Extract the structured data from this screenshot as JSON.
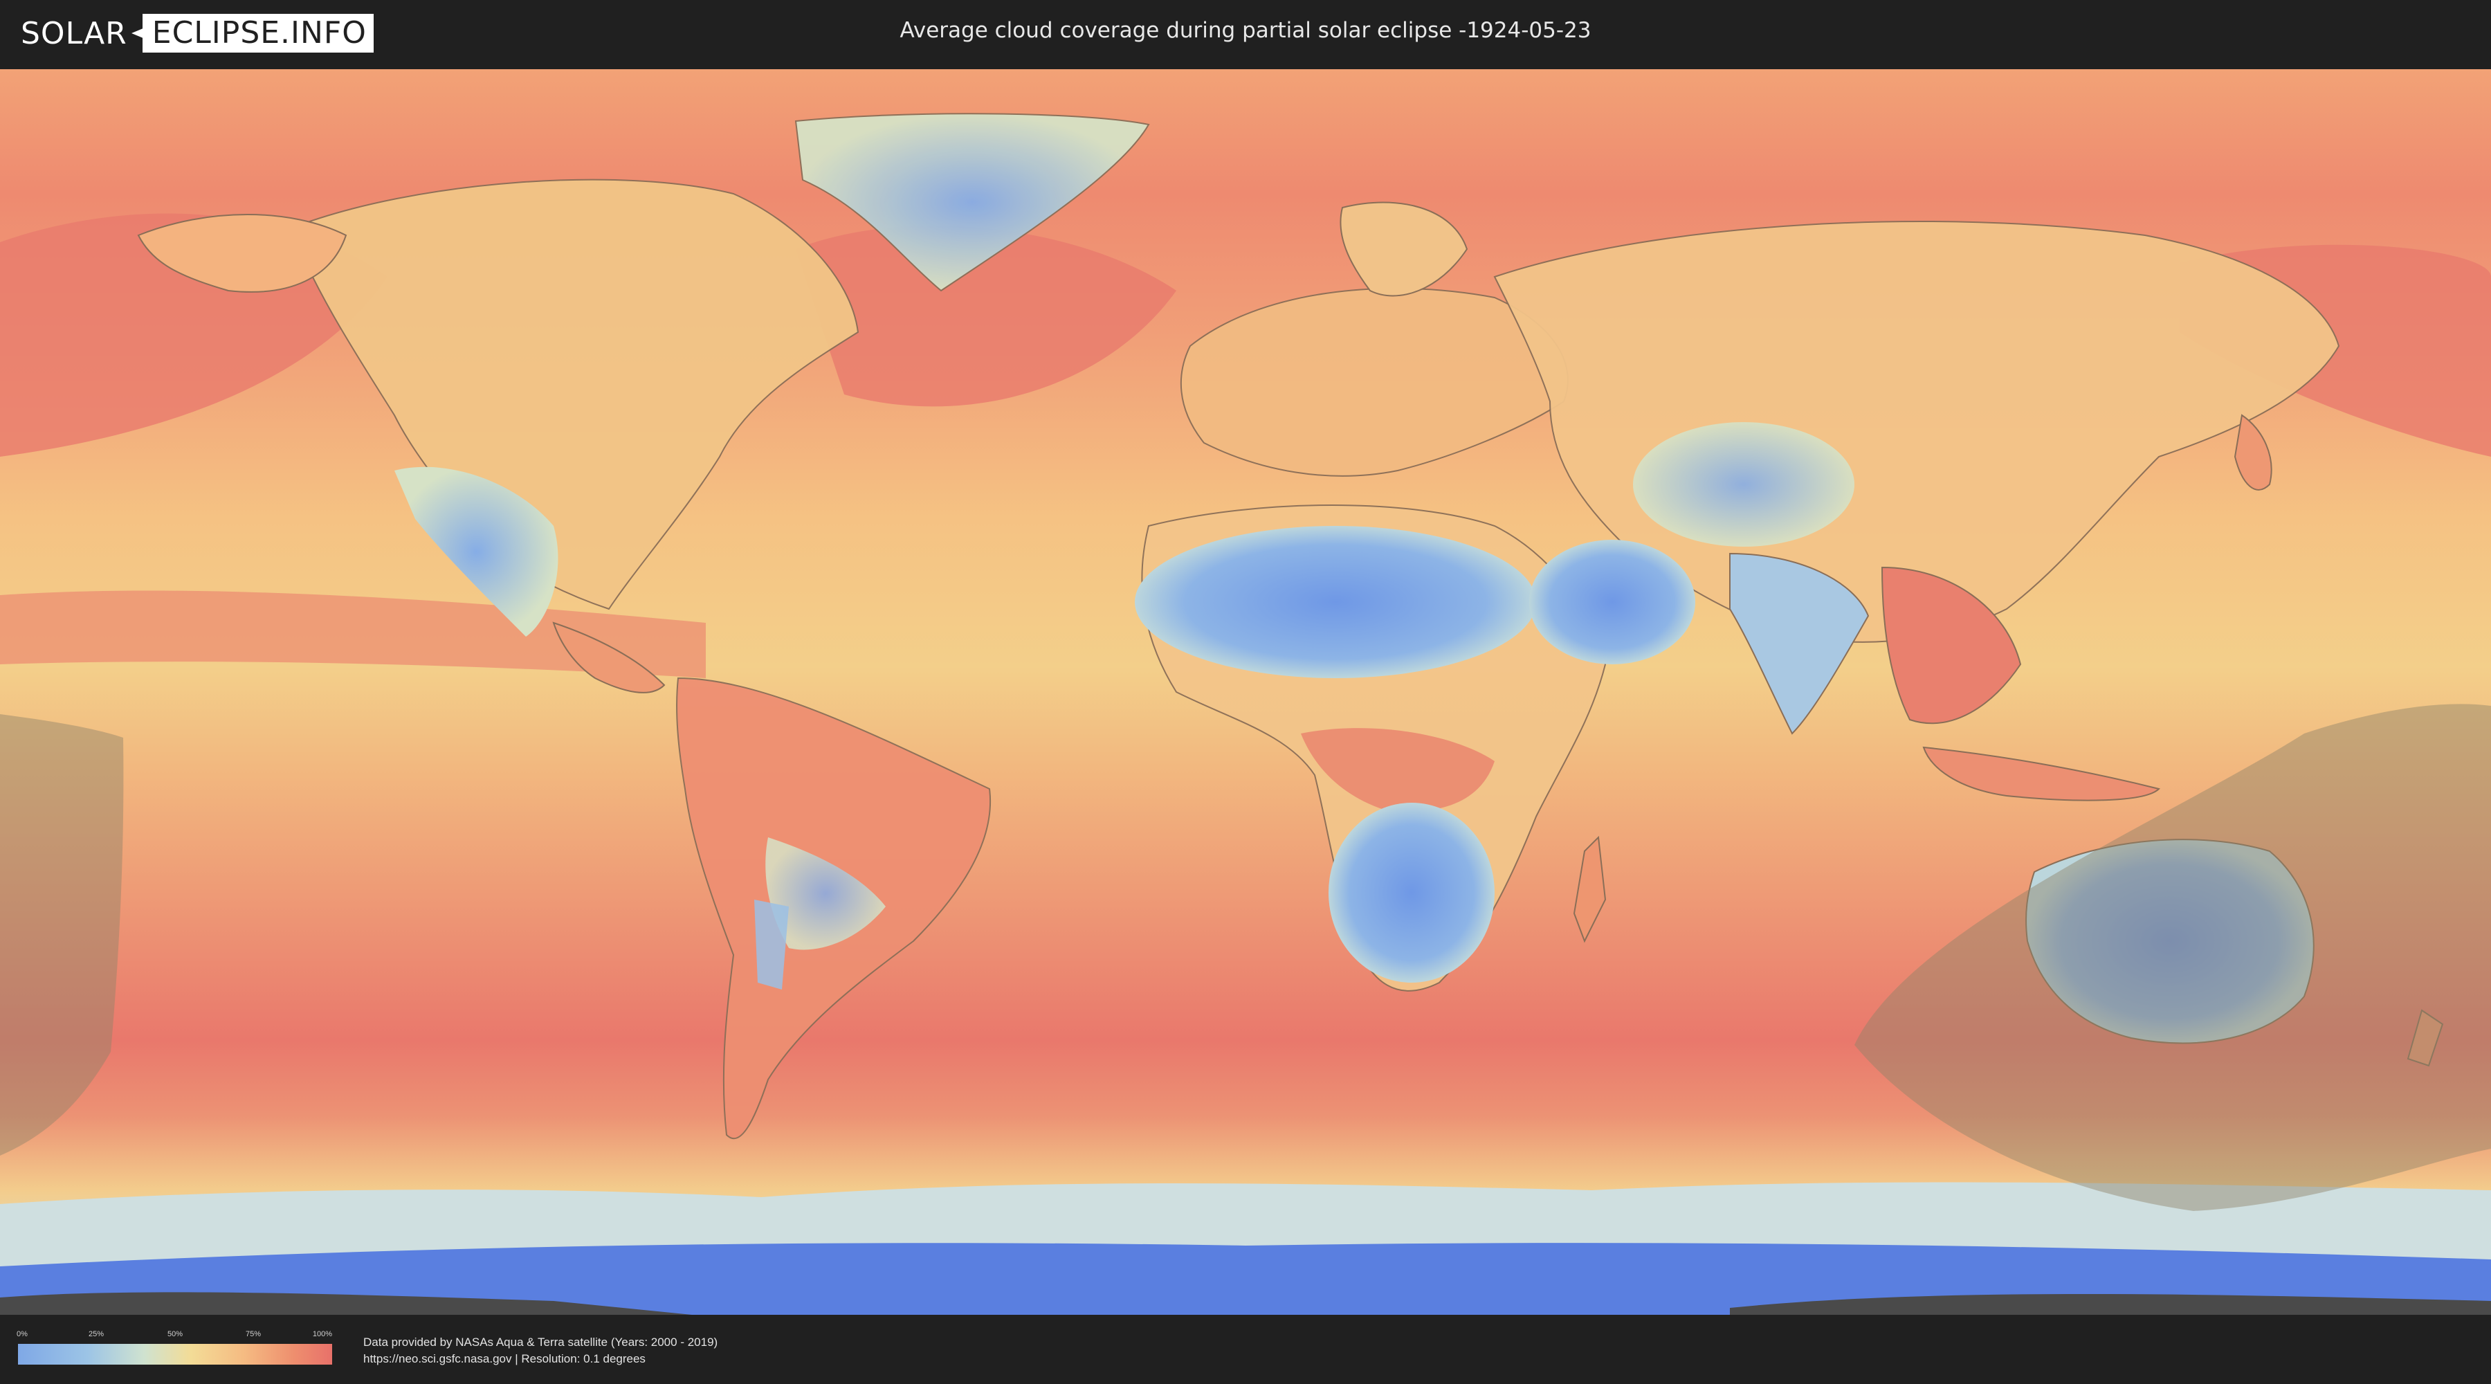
{
  "header": {
    "logo_left": "SOLAR",
    "logo_right": "ECLIPSE.INFO",
    "title": "Average cloud coverage during partial solar eclipse -1924-05-23"
  },
  "legend": {
    "ticks": [
      {
        "label": "0%",
        "value": 0
      },
      {
        "label": "25%",
        "value": 25
      },
      {
        "label": "50%",
        "value": 50
      },
      {
        "label": "75%",
        "value": 75
      },
      {
        "label": "100%",
        "value": 100
      }
    ],
    "colors": [
      "#7fa8e6",
      "#9cc4e6",
      "#cfe2d0",
      "#f3dc97",
      "#f5bb82",
      "#ee8e6e",
      "#e8716a"
    ]
  },
  "credits": {
    "line1": "Data provided by NASAs Aqua & Terra satellite (Years: 2000 - 2019)",
    "line2": "https://neo.sci.gsfc.nasa.gov | Resolution: 0.1 degrees"
  },
  "map": {
    "projection": "equirectangular",
    "ocean_colors": {
      "high_cloud": "#e9766c",
      "mid_cloud": "#f5b27c",
      "low_mid": "#f4d38e"
    },
    "land_colors": {
      "arid": "#7ea6e8",
      "semi_arid": "#a8cbe3",
      "temperate": "#f1d79a",
      "tropical": "#e88a73"
    },
    "polar_color": "#5a7fe0",
    "eclipse_overlay_color": "#8d8368"
  }
}
